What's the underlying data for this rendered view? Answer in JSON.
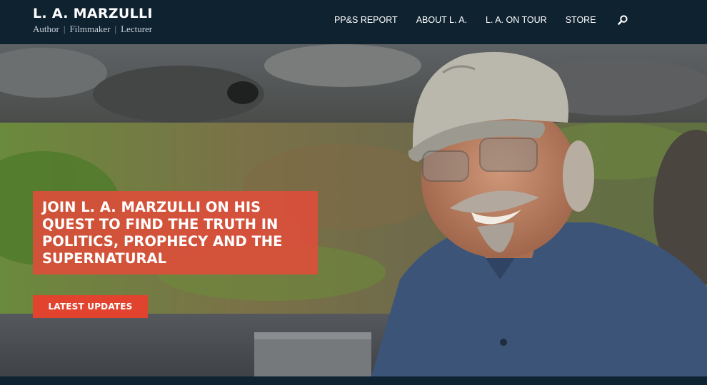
{
  "brand": {
    "title": "L. A. MARZULLI",
    "tagline": [
      "Author",
      "Filmmaker",
      "Lecturer"
    ],
    "separator": "|"
  },
  "nav": {
    "items": [
      {
        "label": "PP&S REPORT"
      },
      {
        "label": "ABOUT L. A."
      },
      {
        "label": "L. A. ON TOUR"
      },
      {
        "label": "STORE"
      }
    ],
    "search_icon": "search-icon"
  },
  "hero": {
    "headline": "JOIN L. A. MARZULLI ON HIS QUEST TO FIND THE TRUTH IN POLITICS, PROPHECY AND THE SUPERNATURAL",
    "cta_label": "LATEST UPDATES",
    "photo": "man-in-cap-outdoors-photo"
  },
  "colors": {
    "header_bg": "#0f2230",
    "accent_red": "#e2432e",
    "headline_box": "#de4e3a",
    "text_white": "#ffffff"
  }
}
